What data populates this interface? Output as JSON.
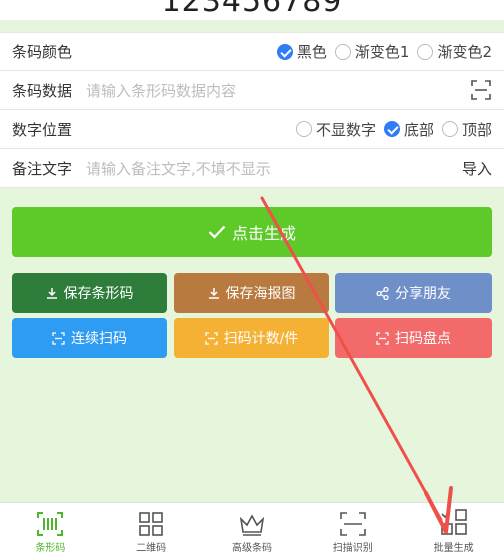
{
  "top_number": "123456789",
  "form": {
    "color": {
      "label": "条码颜色",
      "options": [
        "黑色",
        "渐变色1",
        "渐变色2"
      ],
      "selected": "黑色"
    },
    "data": {
      "label": "条码数据",
      "placeholder": "请输入条形码数据内容",
      "scan_icon": "scan-icon"
    },
    "position": {
      "label": "数字位置",
      "options": [
        "不显数字",
        "底部",
        "顶部"
      ],
      "selected": "底部"
    },
    "note": {
      "label": "备注文字",
      "placeholder": "请输入备注文字,不填不显示",
      "import_label": "导入"
    }
  },
  "generate_label": "点击生成",
  "actions": [
    {
      "label": "保存条形码",
      "icon": "download-icon",
      "color": "#2e7d3b"
    },
    {
      "label": "保存海报图",
      "icon": "download-icon",
      "color": "#b87a3e"
    },
    {
      "label": "分享朋友",
      "icon": "share-icon",
      "color": "#6f8fc8"
    },
    {
      "label": "连续扫码",
      "icon": "scan-icon",
      "color": "#2f9cf4"
    },
    {
      "label": "扫码计数/件",
      "icon": "scan-icon",
      "color": "#f5b133"
    },
    {
      "label": "扫码盘点",
      "icon": "scan-icon",
      "color": "#f26a6a"
    }
  ],
  "tabbar": [
    {
      "label": "条形码",
      "icon": "barcode-icon",
      "active": true
    },
    {
      "label": "二维码",
      "icon": "qrcode-icon",
      "active": false
    },
    {
      "label": "高级条码",
      "icon": "crown-icon",
      "active": false
    },
    {
      "label": "扫描识别",
      "icon": "scan-frame-icon",
      "active": false
    },
    {
      "label": "批量生成",
      "icon": "batch-grid-icon",
      "active": false
    }
  ],
  "colors": {
    "accent_green": "#5dca29",
    "checked_blue": "#2f7cf6",
    "background": "#e6f6dc",
    "annotation_arrow": "#f0504a"
  }
}
